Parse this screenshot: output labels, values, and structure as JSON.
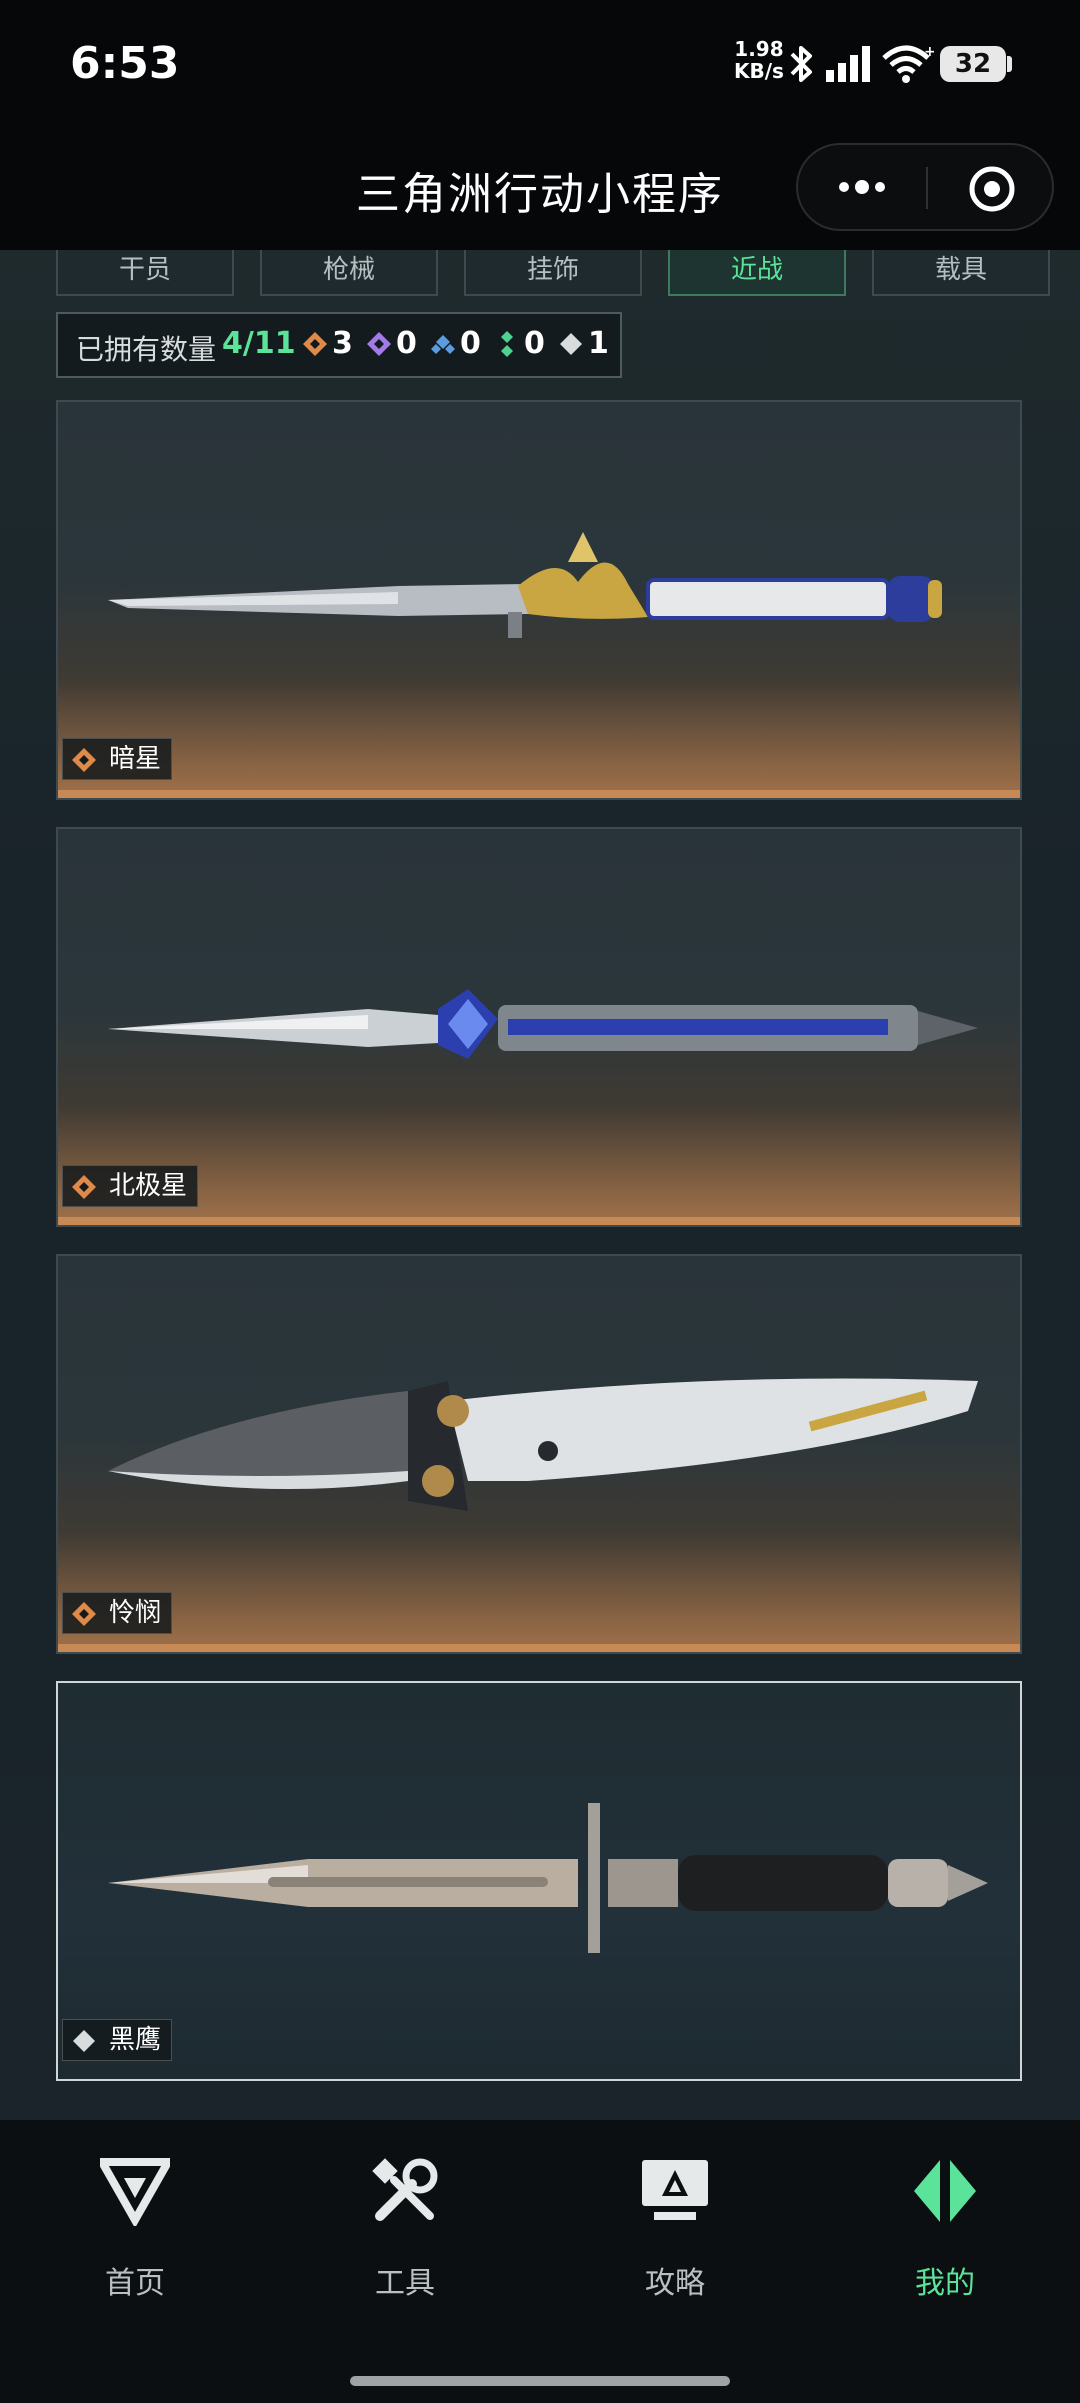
{
  "status_bar": {
    "time": "6:53",
    "net_speed_value": "1.98",
    "net_speed_unit": "KB/s",
    "battery": "32"
  },
  "nav": {
    "title": "三角洲行动小程序"
  },
  "tabs": [
    {
      "label": "干员",
      "active": false
    },
    {
      "label": "枪械",
      "active": false
    },
    {
      "label": "挂饰",
      "active": false
    },
    {
      "label": "近战",
      "active": true
    },
    {
      "label": "载具",
      "active": false
    }
  ],
  "owned": {
    "label": "已拥有数量",
    "count": "4/11",
    "rarities": [
      {
        "icon": "orange-diamond-icon",
        "color": "#e08a4a",
        "value": "3"
      },
      {
        "icon": "purple-diamond-icon",
        "color": "#a27be8",
        "value": "0"
      },
      {
        "icon": "blue-diamond-icon",
        "color": "#5b9de0",
        "value": "0"
      },
      {
        "icon": "green-diamond-icon",
        "color": "#4fd18f",
        "value": "0"
      },
      {
        "icon": "white-diamond-icon",
        "color": "#d8dcdd",
        "value": "1"
      }
    ]
  },
  "items": [
    {
      "name": "暗星",
      "rarity": "orange",
      "color": "#e08a4a"
    },
    {
      "name": "北极星",
      "rarity": "orange",
      "color": "#e08a4a"
    },
    {
      "name": "怜悯",
      "rarity": "orange",
      "color": "#e08a4a"
    },
    {
      "name": "黑鹰",
      "rarity": "white",
      "color": "#d8dcdd"
    }
  ],
  "bottom_nav": [
    {
      "label": "首页",
      "icon": "delta-logo-icon",
      "active": false
    },
    {
      "label": "工具",
      "icon": "tools-icon",
      "active": false
    },
    {
      "label": "攻略",
      "icon": "guide-monitor-icon",
      "active": false
    },
    {
      "label": "我的",
      "icon": "profile-logo-icon",
      "active": true
    }
  ],
  "colors": {
    "accent_green": "#5ce39a",
    "background": "#050708",
    "orange_rarity": "#e08a4a"
  }
}
